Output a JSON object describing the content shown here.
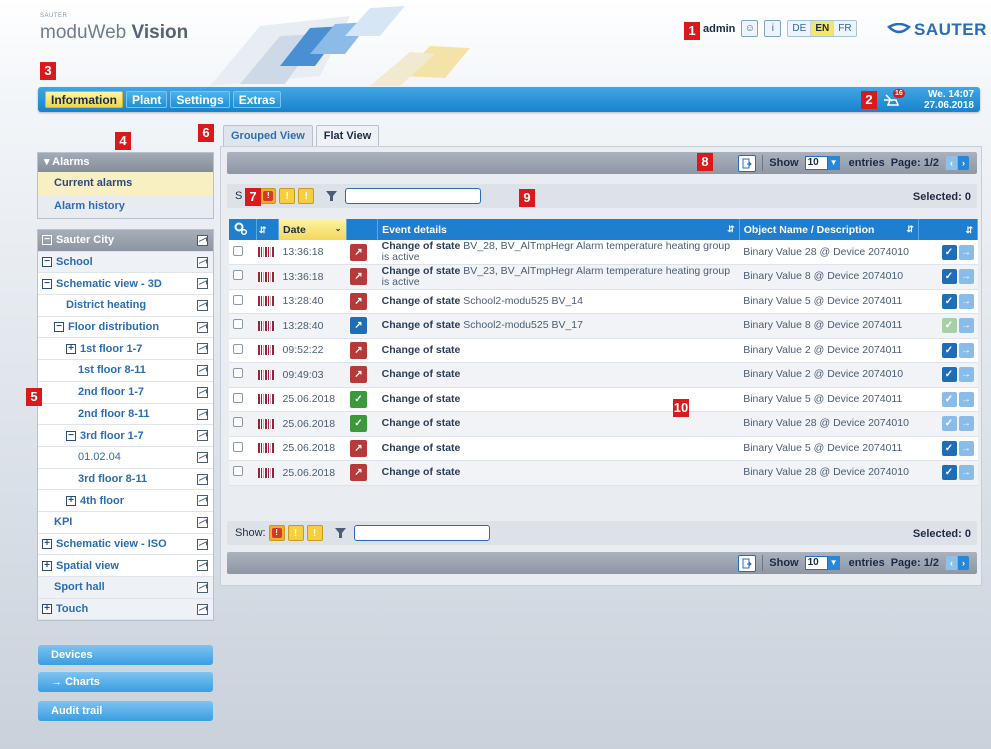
{
  "header": {
    "brand_small": "SAUTER",
    "brand_light": "moduWeb",
    "brand_bold": "Vision",
    "user": "admin",
    "languages": [
      "DE",
      "EN",
      "FR"
    ],
    "selected_language": "EN",
    "logo_text": "SAUTER"
  },
  "markers": [
    "1",
    "2",
    "3",
    "4",
    "5",
    "6",
    "7",
    "8",
    "9",
    "10"
  ],
  "nav": {
    "items": [
      "Information",
      "Plant",
      "Settings",
      "Extras"
    ],
    "selected": "Information",
    "alarm_count": "16",
    "clock_day_time": "We. 14:07",
    "clock_date": "27.06.2018"
  },
  "sidebar": {
    "alarms_header": "Alarms",
    "alarms_items": [
      "Current alarms",
      "Alarm history"
    ],
    "tree": [
      {
        "label": "Sauter City",
        "exp": "−",
        "indent": 0,
        "style": "head"
      },
      {
        "label": "School",
        "exp": "−",
        "indent": 0,
        "style": "lvl0b"
      },
      {
        "label": "Schematic view - 3D",
        "exp": "−",
        "indent": 0,
        "style": ""
      },
      {
        "label": "District heating",
        "exp": "",
        "indent": 2,
        "style": ""
      },
      {
        "label": "Floor distribution",
        "exp": "−",
        "indent": 1,
        "style": ""
      },
      {
        "label": "1st floor 1-7",
        "exp": "+",
        "indent": 2,
        "style": ""
      },
      {
        "label": "1st floor 8-11",
        "exp": "",
        "indent": 3,
        "style": ""
      },
      {
        "label": "2nd floor 1-7",
        "exp": "",
        "indent": 3,
        "style": ""
      },
      {
        "label": "2nd floor 8-11",
        "exp": "",
        "indent": 3,
        "style": ""
      },
      {
        "label": "3rd floor 1-7",
        "exp": "−",
        "indent": 2,
        "style": ""
      },
      {
        "label": "01.02.04",
        "exp": "",
        "indent": 3,
        "style": "plain"
      },
      {
        "label": "3rd floor 8-11",
        "exp": "",
        "indent": 3,
        "style": ""
      },
      {
        "label": "4th floor",
        "exp": "+",
        "indent": 2,
        "style": ""
      },
      {
        "label": "KPI",
        "exp": "",
        "indent": 1,
        "style": ""
      },
      {
        "label": "Schematic view - ISO",
        "exp": "+",
        "indent": 0,
        "style": ""
      },
      {
        "label": "Spatial view",
        "exp": "+",
        "indent": 0,
        "style": ""
      },
      {
        "label": "Sport hall",
        "exp": "",
        "indent": 1,
        "style": "lvl0b"
      },
      {
        "label": "Touch",
        "exp": "+",
        "indent": 0,
        "style": "lvl0b"
      }
    ],
    "bottom_buttons": [
      "Devices",
      "Charts",
      "Audit trail"
    ]
  },
  "tabs": [
    "Grouped View",
    "Flat View"
  ],
  "selected_tab": "Flat View",
  "toolbar": {
    "show_label": "Show",
    "entries_value": "10",
    "entries_label": "entries",
    "page_label": "Page: 1/2",
    "selected_label": "Selected: 0",
    "filter_prefix": "S",
    "filter_label_bottom": "Show:"
  },
  "table": {
    "columns": [
      "Date",
      "Event details",
      "Object Name / Description"
    ],
    "rows": [
      {
        "time": "13:36:18",
        "icon": "red",
        "bold": "Change of state",
        "rest": " BV_28, BV_AlTmpHegr Alarm temperature heating group is active",
        "object": "Binary Value 28 @ Device 2074010",
        "ack": "a"
      },
      {
        "time": "13:36:18",
        "icon": "red",
        "bold": "Change of state",
        "rest": " BV_23, BV_AlTmpHegr Alarm temperature heating group is active",
        "object": "Binary Value 8 @ Device 2074010",
        "ack": "a"
      },
      {
        "time": "13:28:40",
        "icon": "red",
        "bold": "Change of state",
        "rest": " School2-modu525 BV_14",
        "object": "Binary Value 5 @ Device 2074011",
        "ack": "a"
      },
      {
        "time": "13:28:40",
        "icon": "blue",
        "bold": "Change of state",
        "rest": " School2-modu525 BV_17",
        "object": "Binary Value 8 @ Device 2074011",
        "ack": "c"
      },
      {
        "time": "09:52:22",
        "icon": "red",
        "bold": "Change of state",
        "rest": "",
        "object": "Binary Value 2 @ Device 2074011",
        "ack": "a"
      },
      {
        "time": "09:49:03",
        "icon": "red",
        "bold": "Change of state",
        "rest": "",
        "object": "Binary Value 2 @ Device 2074010",
        "ack": "a"
      },
      {
        "time": "25.06.2018",
        "icon": "green",
        "bold": "Change of state",
        "rest": "",
        "object": "Binary Value 5 @ Device 2074011",
        "ack": "b"
      },
      {
        "time": "25.06.2018",
        "icon": "green",
        "bold": "Change of state",
        "rest": "",
        "object": "Binary Value 28 @ Device 2074010",
        "ack": "b"
      },
      {
        "time": "25.06.2018",
        "icon": "red",
        "bold": "Change of state",
        "rest": "",
        "object": "Binary Value 5 @ Device 2074011",
        "ack": "a"
      },
      {
        "time": "25.06.2018",
        "icon": "red",
        "bold": "Change of state",
        "rest": "",
        "object": "Binary Value 28 @ Device 2074010",
        "ack": "a"
      }
    ]
  },
  "colors": {
    "accent_blue": "#1e7ed0",
    "selected_yellow": "#f3d858",
    "alarm_red": "#b63a3a",
    "marker_red": "#d9191c"
  }
}
